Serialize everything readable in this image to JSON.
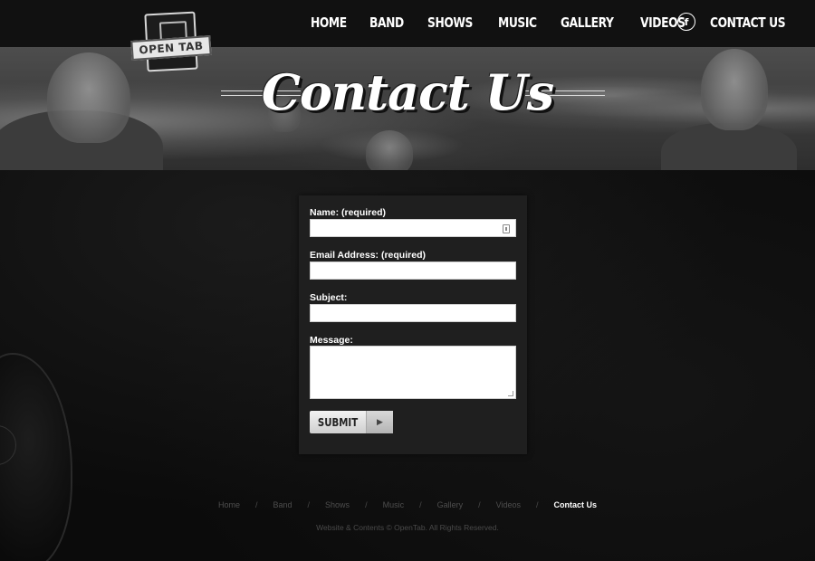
{
  "brand": {
    "logo_text": "OPEN TAB"
  },
  "nav": {
    "items": [
      "HOME",
      "BAND",
      "SHOWS",
      "MUSIC",
      "GALLERY",
      "VIDEOS",
      "CONTACT US"
    ],
    "facebook_glyph": "f"
  },
  "hero": {
    "title": "Contact Us"
  },
  "form": {
    "name_label": "Name: (required)",
    "email_label": "Email Address: (required)",
    "subject_label": "Subject:",
    "message_label": "Message:",
    "name_value": "",
    "email_value": "",
    "subject_value": "",
    "message_value": "",
    "submit_label": "SUBMIT",
    "submit_arrow_glyph": "▶"
  },
  "footer": {
    "links": [
      "Home",
      "Band",
      "Shows",
      "Music",
      "Gallery",
      "Videos",
      "Contact Us"
    ],
    "separator": "/",
    "active_link": "Contact Us",
    "copyright": "Website & Contents © OpenTab. All Rights Reserved."
  },
  "colors": {
    "background": "#0d0d0d",
    "panel": "#1f1f1f",
    "text": "#ffffff",
    "muted": "#4e4e4e"
  }
}
